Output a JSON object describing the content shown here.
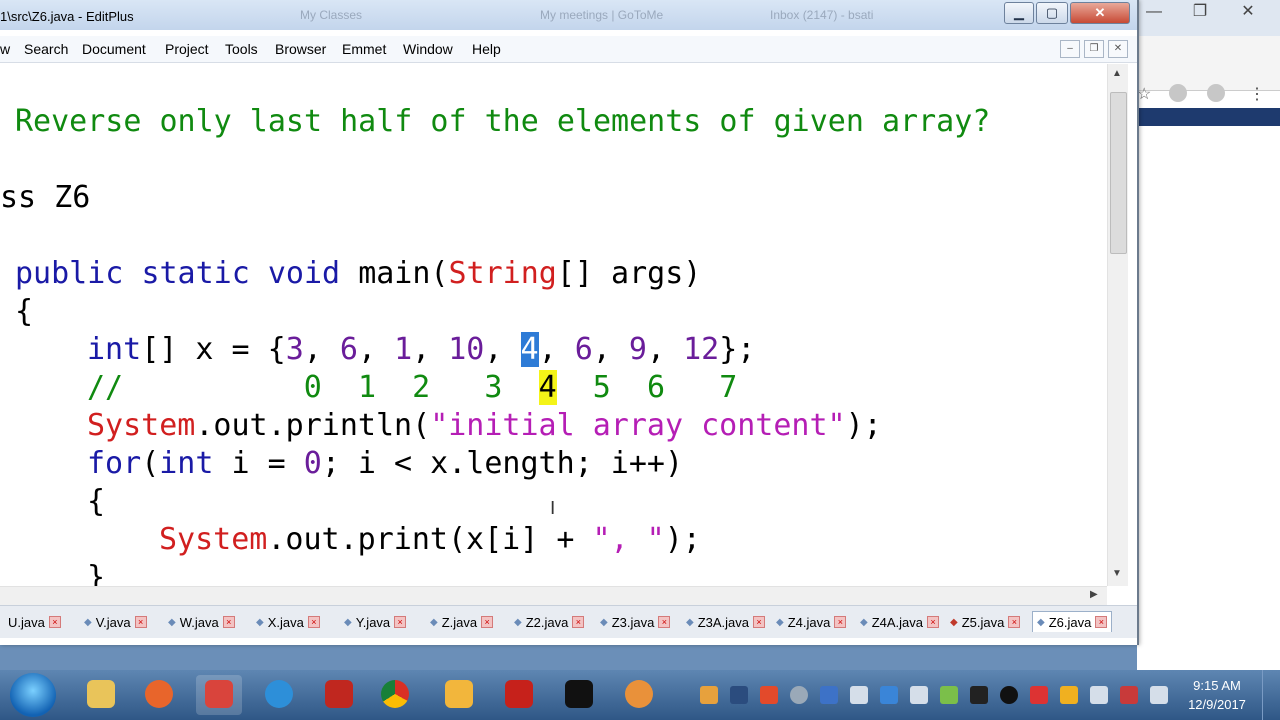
{
  "window": {
    "title": "1\\src\\Z6.java - EditPlus",
    "ghost_tabs": [
      "My Classes",
      "My meetings | GoToMe",
      "Inbox (2147) - bsati"
    ]
  },
  "menu": [
    "w",
    "Search",
    "Document",
    "Project",
    "Tools",
    "Browser",
    "Emmet",
    "Window",
    "Help"
  ],
  "editor": {
    "comment": "Reverse only last half of the elements of given array?",
    "class_line": "ss Z6",
    "main_sig": {
      "kw1": "public",
      "kw2": "static",
      "kw3": "void",
      "name": "main(",
      "type": "String",
      "rest": "[] args)"
    },
    "brace_open": "{",
    "array_line": {
      "decl_kw": "int",
      "decl_rest": "[] x = {",
      "values": [
        "3",
        "6",
        "1",
        "10",
        "4",
        "6",
        "9",
        "12"
      ],
      "end": "};"
    },
    "index_comment": {
      "slashes": "//",
      "indices": [
        "0",
        "1",
        "2",
        "3",
        "4",
        "5",
        "6",
        "7"
      ]
    },
    "println": {
      "cls": "System",
      "mid": ".out.println(",
      "str": "\"initial array content\"",
      "end": ");"
    },
    "for_line": {
      "kw": "for",
      "p1": "(",
      "kw2": "int",
      "p2": " i = ",
      "n": "0",
      "p3": "; i < x.length; i++)"
    },
    "brace_open2": "{",
    "print_line": {
      "cls": "System",
      "mid": ".out.print(x[i] + ",
      "str": "\", \"",
      "end": ");"
    },
    "brace_close": "}"
  },
  "file_tabs": [
    "U.java",
    "V.java",
    "W.java",
    "X.java",
    "Y.java",
    "Z.java",
    "Z2.java",
    "Z3.java",
    "Z3A.java",
    "Z4.java",
    "Z4A.java",
    "Z5.java",
    "Z6.java"
  ],
  "active_tab": "Z6.java",
  "clock": {
    "time": "9:15 AM",
    "date": "12/9/2017"
  }
}
